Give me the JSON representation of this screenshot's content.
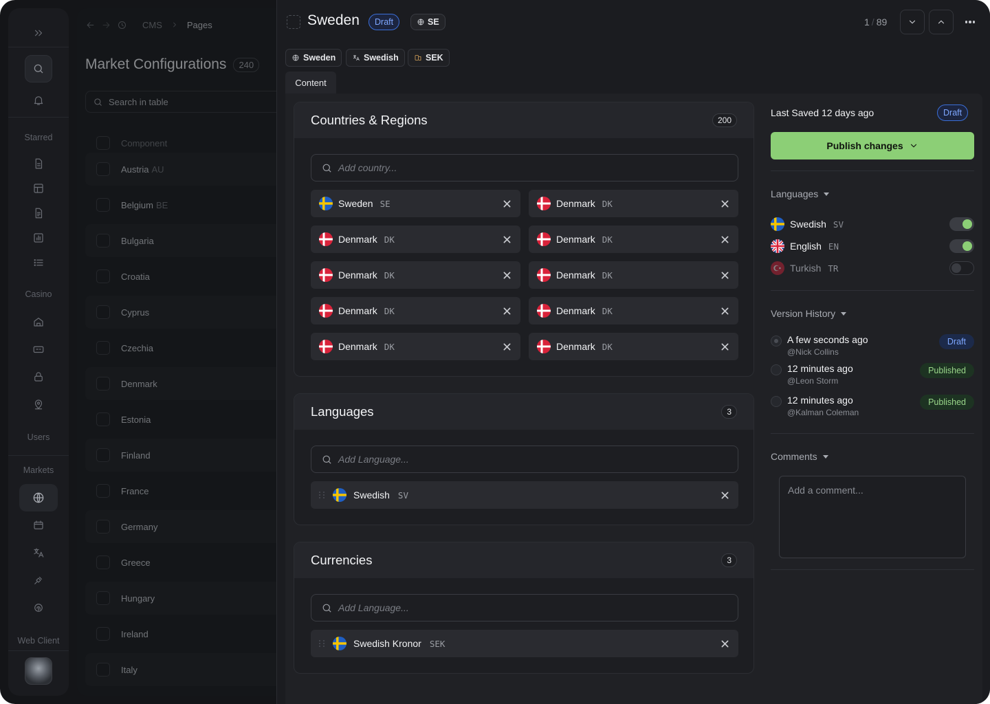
{
  "rail": {
    "sections": {
      "starred": "Starred",
      "casino": "Casino",
      "users": "Users",
      "markets": "Markets",
      "web_client": "Web Client"
    }
  },
  "list": {
    "breadcrumb": [
      "CMS",
      "Pages"
    ],
    "title": "Market Configurations",
    "count": "240",
    "search_placeholder": "Search in table",
    "header": "Component",
    "rows": [
      {
        "name": "Austria",
        "code": "AU"
      },
      {
        "name": "Belgium",
        "code": "BE"
      },
      {
        "name": "Bulgaria",
        "code": ""
      },
      {
        "name": "Croatia",
        "code": ""
      },
      {
        "name": "Cyprus",
        "code": ""
      },
      {
        "name": "Czechia",
        "code": ""
      },
      {
        "name": "Denmark",
        "code": ""
      },
      {
        "name": "Estonia",
        "code": ""
      },
      {
        "name": "Finland",
        "code": ""
      },
      {
        "name": "France",
        "code": ""
      },
      {
        "name": "Germany",
        "code": ""
      },
      {
        "name": "Greece",
        "code": ""
      },
      {
        "name": "Hungary",
        "code": ""
      },
      {
        "name": "Ireland",
        "code": ""
      },
      {
        "name": "Italy",
        "code": ""
      }
    ]
  },
  "doc": {
    "title": "Sweden",
    "status": "Draft",
    "market_code": "SE",
    "pager": {
      "current": "1",
      "total": "89"
    },
    "tags": [
      {
        "label": "Sweden",
        "icon": "globe-icon"
      },
      {
        "label": "Swedish",
        "icon": "translate-icon"
      },
      {
        "label": "SEK",
        "icon": "currency-icon"
      }
    ],
    "tab": "Content"
  },
  "countries": {
    "title": "Countries & Regions",
    "count": "200",
    "placeholder": "Add country...",
    "items": [
      {
        "name": "Sweden",
        "code": "SE",
        "flag": "se"
      },
      {
        "name": "Denmark",
        "code": "DK",
        "flag": "dk"
      },
      {
        "name": "Denmark",
        "code": "DK",
        "flag": "dk"
      },
      {
        "name": "Denmark",
        "code": "DK",
        "flag": "dk"
      },
      {
        "name": "Denmark",
        "code": "DK",
        "flag": "dk"
      },
      {
        "name": "Denmark",
        "code": "DK",
        "flag": "dk"
      },
      {
        "name": "Denmark",
        "code": "DK",
        "flag": "dk"
      },
      {
        "name": "Denmark",
        "code": "DK",
        "flag": "dk"
      },
      {
        "name": "Denmark",
        "code": "DK",
        "flag": "dk"
      },
      {
        "name": "Denmark",
        "code": "DK",
        "flag": "dk"
      }
    ]
  },
  "languages": {
    "title": "Languages",
    "count": "3",
    "placeholder": "Add Language...",
    "items": [
      {
        "name": "Swedish",
        "code": "SV",
        "flag": "se"
      }
    ]
  },
  "currencies": {
    "title": "Currencies",
    "count": "3",
    "placeholder": "Add Language...",
    "items": [
      {
        "name": "Swedish Kronor",
        "code": "SEK",
        "flag": "se"
      }
    ]
  },
  "sidebar": {
    "last_saved": "Last Saved 12 days ago",
    "status": "Draft",
    "publish_label": "Publish changes",
    "languages_title": "Languages",
    "languages": [
      {
        "name": "Swedish",
        "code": "SV",
        "enabled": true
      },
      {
        "name": "English",
        "code": "EN",
        "enabled": true
      },
      {
        "name": "Turkish",
        "code": "TR",
        "enabled": false
      }
    ],
    "history_title": "Version History",
    "history": [
      {
        "when": "A few seconds ago",
        "who": "@Nick Collins",
        "status": "Draft"
      },
      {
        "when": "12 minutes ago",
        "who": "@Leon Storm",
        "status": "Published"
      },
      {
        "when": "12 minutes ago",
        "who": "@Kalman Coleman",
        "status": "Published"
      }
    ],
    "comments_title": "Comments",
    "comment_placeholder": "Add a comment..."
  },
  "colors": {
    "accent": "#8ccf76",
    "draft": "#7ea7ff",
    "published": "#9ad68a"
  }
}
